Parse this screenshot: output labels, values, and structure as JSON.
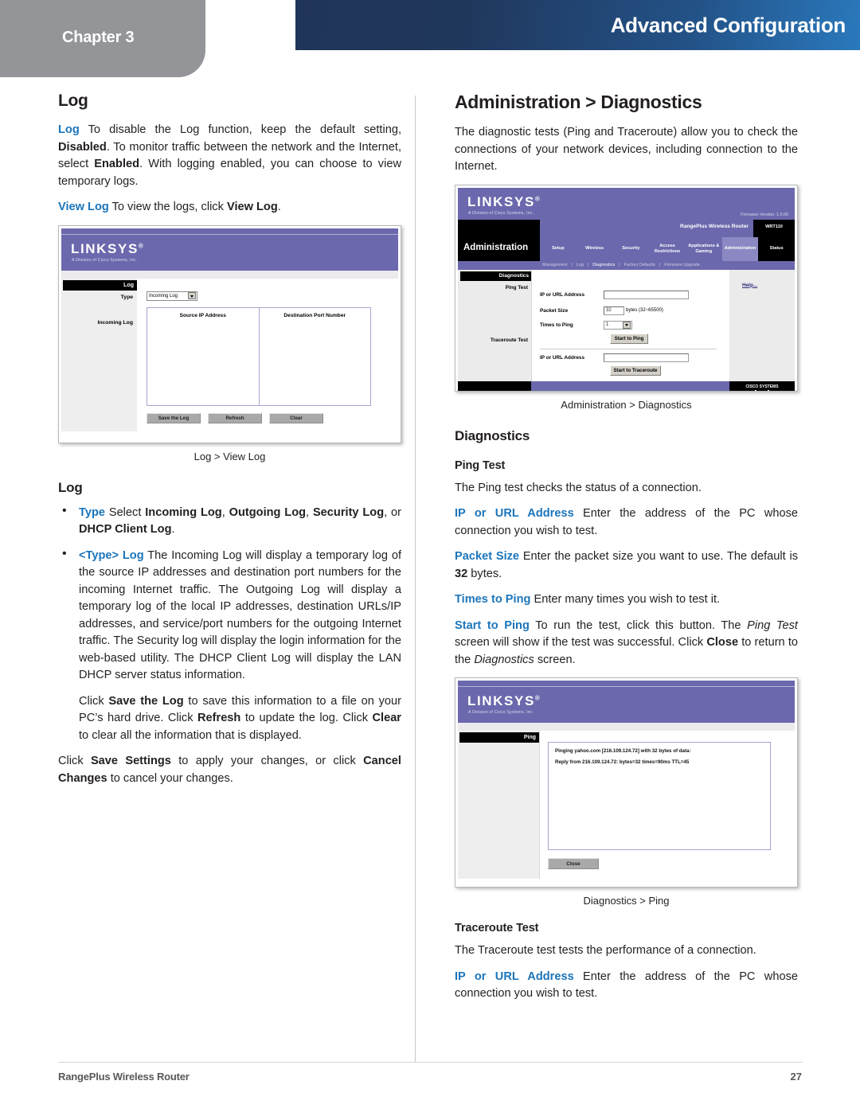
{
  "header": {
    "chapter_label": "Chapter 3",
    "title": "Advanced Configuration",
    "band_color_start": "#20375c",
    "band_color_end": "#2a79bd",
    "chapter_tab_color": "#939598"
  },
  "accent_color": "#1b75bb",
  "left_column": {
    "heading": "Log",
    "paragraph1": {
      "term": "Log",
      "text_a": " To disable the Log function, keep the default setting, ",
      "bold_a": "Disabled",
      "text_b": ". To monitor traffic between the network and the Internet, select ",
      "bold_b": "Enabled",
      "text_c": ". With logging enabled, you can choose to view temporary logs."
    },
    "paragraph2": {
      "term": "View Log",
      "text_a": " To view the logs, click ",
      "bold_a": "View Log",
      "text_b": "."
    },
    "figure1": {
      "caption": "Log > View Log",
      "brand": "LINKSYS",
      "brand_sub": "A Division of Cisco Systems, Inc.",
      "nav_header": "Log",
      "labels": [
        "Type",
        "Incoming Log"
      ],
      "select_value": "Incoming Log",
      "table_headers": [
        "Source IP Address",
        "Destination Port Number"
      ],
      "buttons": [
        "Save the Log",
        "Refresh",
        "Clear"
      ]
    },
    "heading2": "Log",
    "bullets": [
      {
        "term": "Type",
        "text_a": " Select ",
        "bold_a": "Incoming Log",
        "text_b": ", ",
        "bold_b": "Outgoing Log",
        "text_c": ", ",
        "bold_c": "Security Log",
        "text_d": ", or ",
        "bold_d": "DHCP Client Log",
        "text_e": "."
      },
      {
        "term": "<Type> Log",
        "text_a": " The Incoming Log will display a temporary log of the source IP addresses and destination port numbers for the incoming Internet traffic. The Outgoing Log will display a temporary log of the local IP addresses, destination URLs/IP addresses, and service/port numbers for the outgoing Internet traffic. The Security log will display the login information for the web-based utility. The DHCP Client Log will display the LAN DHCP server status information."
      }
    ],
    "indented_paragraph": {
      "text_a": "Click ",
      "bold_a": "Save the Log",
      "text_b": " to save this information to a file on your PC’s hard drive. Click ",
      "bold_b": "Refresh",
      "text_c": " to update the log. Click ",
      "bold_c": "Clear",
      "text_d": " to clear all the information that is displayed."
    },
    "closing_paragraph": {
      "text_a": "Click ",
      "bold_a": "Save Settings",
      "text_b": " to apply your changes, or click ",
      "bold_b": "Cancel Changes",
      "text_c": " to cancel your changes."
    }
  },
  "right_column": {
    "heading": "Administration > Diagnostics",
    "intro": "The diagnostic tests (Ping and Traceroute) allow you to check the connections of your network devices, including connection to the Internet.",
    "figure1": {
      "caption": "Administration > Diagnostics",
      "brand": "LINKSYS",
      "brand_sub": "A Division of Cisco Systems, Inc.",
      "firmware": "Firmware Version: 1.0.00",
      "model_title": "RangePlus Wireless Router",
      "model_number": "WRT110",
      "side_title": "Administration",
      "tabs": [
        "Setup",
        "Wireless",
        "Security",
        "Access Restrictions",
        "Applications & Gaming",
        "Administration",
        "Status"
      ],
      "selected_tab": "Administration",
      "subtabs": [
        "Management",
        "Log",
        "Diagnostics",
        "Factory Defaults",
        "Firmware Upgrade"
      ],
      "selected_subtab": "Diagnostics",
      "nav_header": "Diagnostics",
      "section_labels": [
        "Ping Test",
        "Traceroute Test"
      ],
      "ping_fields": [
        {
          "label": "IP or URL Address",
          "value": ""
        },
        {
          "label": "Packet Size",
          "value": "32",
          "suffix": "bytes (32~65500)"
        },
        {
          "label": "Times to Ping",
          "value": "1"
        }
      ],
      "ping_button": "Start to Ping",
      "traceroute_field": {
        "label": "IP or URL Address",
        "value": ""
      },
      "traceroute_button": "Start to Traceroute",
      "help_link": "Help...",
      "brand_footer": "CISCO SYSTEMS"
    },
    "heading2": "Diagnostics",
    "ping_test": {
      "heading": "Ping Test",
      "intro": "The Ping test checks the status of a connection.",
      "items": [
        {
          "term": "IP or URL Address",
          "text_a": " Enter the address of the PC whose connection you wish to test."
        },
        {
          "term": "Packet Size",
          "text_a": " Enter the packet size you want to use. The default is ",
          "bold_a": "32",
          "text_b": " bytes."
        },
        {
          "term": "Times to Ping",
          "text_a": " Enter many times you wish to test it."
        },
        {
          "term": "Start to Ping",
          "text_a": " To run the test, click this button. The ",
          "ital_a": "Ping Test",
          "text_b": " screen will show if the test was successful. Click ",
          "bold_a": "Close",
          "text_c": " to return to the ",
          "ital_b": "Diagnostics",
          "text_d": " screen."
        }
      ]
    },
    "figure2": {
      "caption": "Diagnostics > Ping",
      "brand": "LINKSYS",
      "brand_sub": "A Division of Cisco Systems, Inc.",
      "nav_header": "Ping",
      "output_lines": [
        "Pinging yahoo.com [216.109.124.72] with 32 bytes of data:",
        "Reply from 216.109.124.72: bytes=32 times=90ms TTL=45"
      ],
      "close_button": "Close"
    },
    "traceroute_test": {
      "heading": "Traceroute Test",
      "intro": "The Traceroute test tests the performance of a connection.",
      "items": [
        {
          "term": "IP or URL Address",
          "text_a": " Enter the address of the PC whose connection you wish to test."
        }
      ]
    }
  },
  "footer": {
    "left": "RangePlus Wireless Router",
    "page_number": "27"
  }
}
